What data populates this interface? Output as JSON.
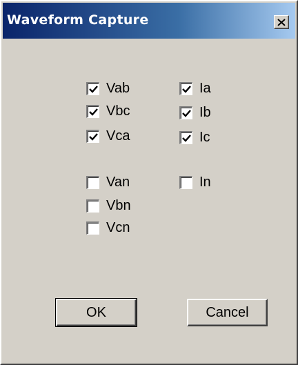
{
  "window": {
    "title": "Waveform Capture"
  },
  "checkboxes": {
    "vab": {
      "label": "Vab",
      "checked": true
    },
    "vbc": {
      "label": "Vbc",
      "checked": true
    },
    "vca": {
      "label": "Vca",
      "checked": true
    },
    "ia": {
      "label": "Ia",
      "checked": true
    },
    "ib": {
      "label": "Ib",
      "checked": true
    },
    "ic": {
      "label": "Ic",
      "checked": true
    },
    "van": {
      "label": "Van",
      "checked": false
    },
    "vbn": {
      "label": "Vbn",
      "checked": false
    },
    "vcn": {
      "label": "Vcn",
      "checked": false
    },
    "in": {
      "label": "In",
      "checked": false
    }
  },
  "buttons": {
    "ok": "OK",
    "cancel": "Cancel"
  },
  "colors": {
    "titlebar_start": "#0a246a",
    "titlebar_end": "#a6caf0",
    "dialog_face": "#d4d0c8"
  },
  "icons": {
    "close": "close-icon",
    "check": "checkmark-icon"
  }
}
